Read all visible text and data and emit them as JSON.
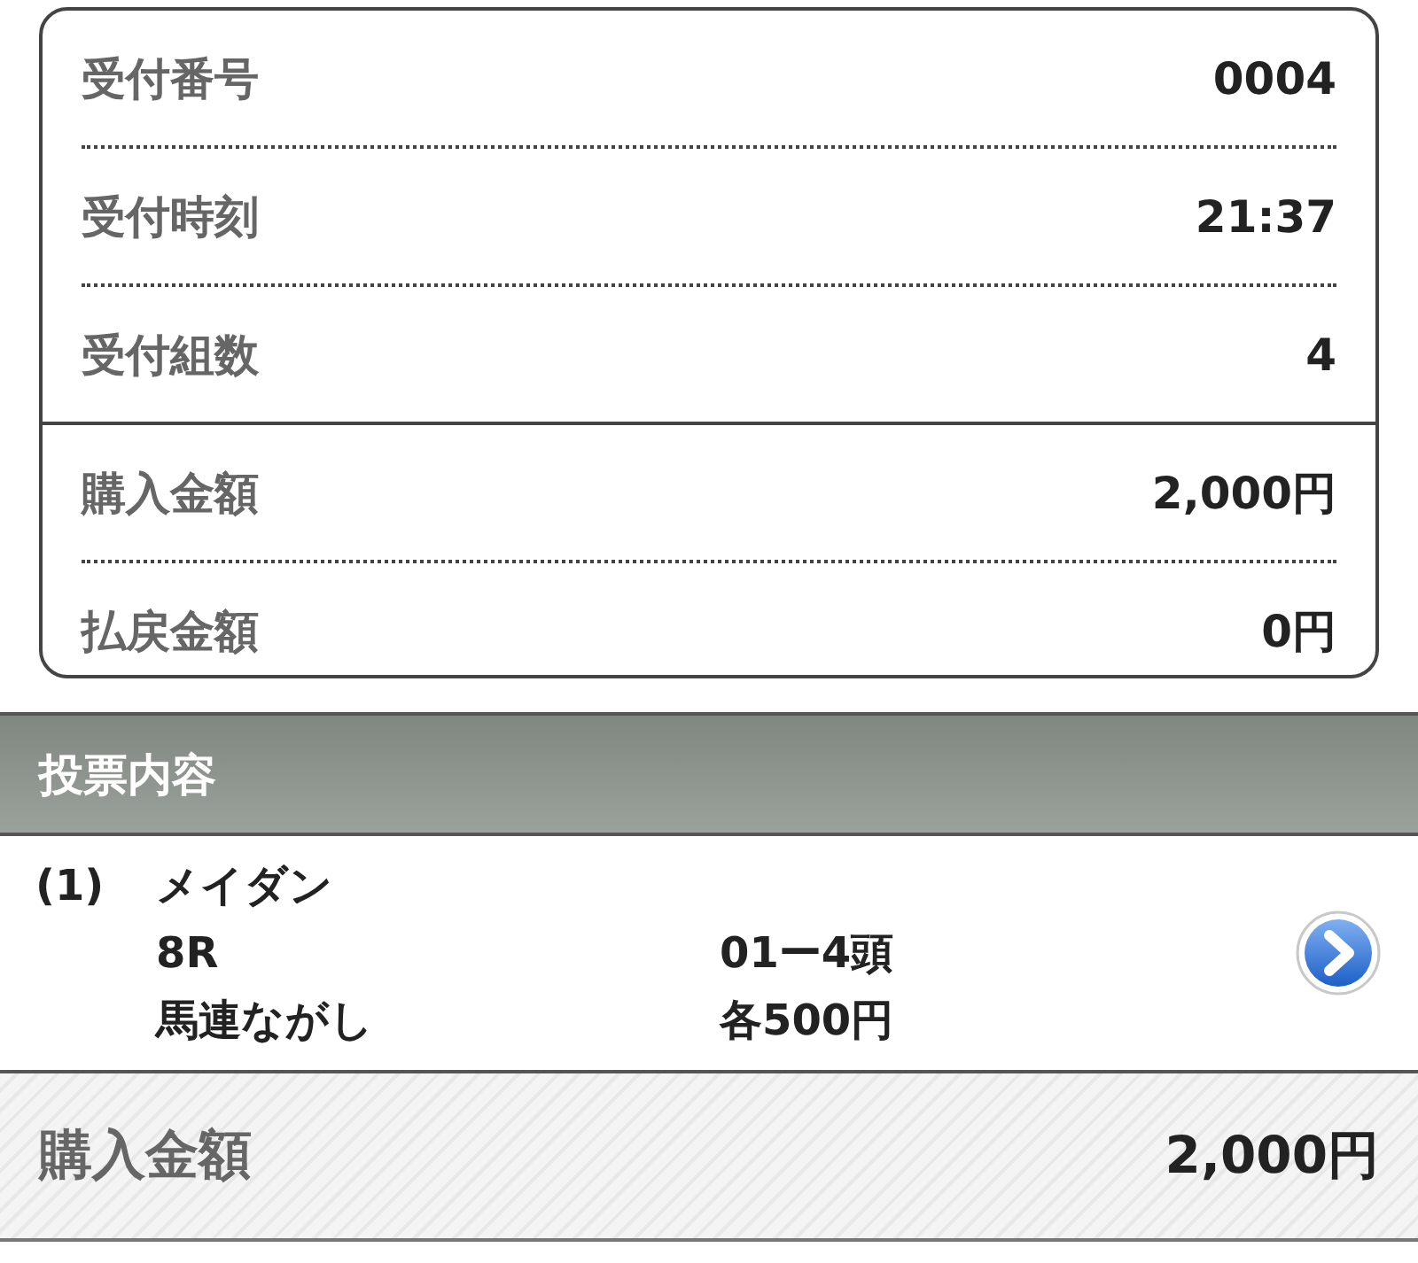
{
  "receipt": {
    "groups": [
      [
        {
          "label": "受付番号",
          "value": "0004"
        },
        {
          "label": "受付時刻",
          "value": "21:37"
        },
        {
          "label": "受付組数",
          "value": "4"
        }
      ],
      [
        {
          "label": "購入金額",
          "value": "2,000円"
        },
        {
          "label": "払戻金額",
          "value": "0円"
        }
      ]
    ]
  },
  "section": {
    "title": "投票内容"
  },
  "bets": [
    {
      "number": "(1)",
      "race_name": "メイダン",
      "race": "8R",
      "combination": "01ー4頭",
      "bet_type": "馬連ながし",
      "amount": "各500円"
    }
  ],
  "total": {
    "label": "購入金額",
    "value": "2,000円"
  }
}
